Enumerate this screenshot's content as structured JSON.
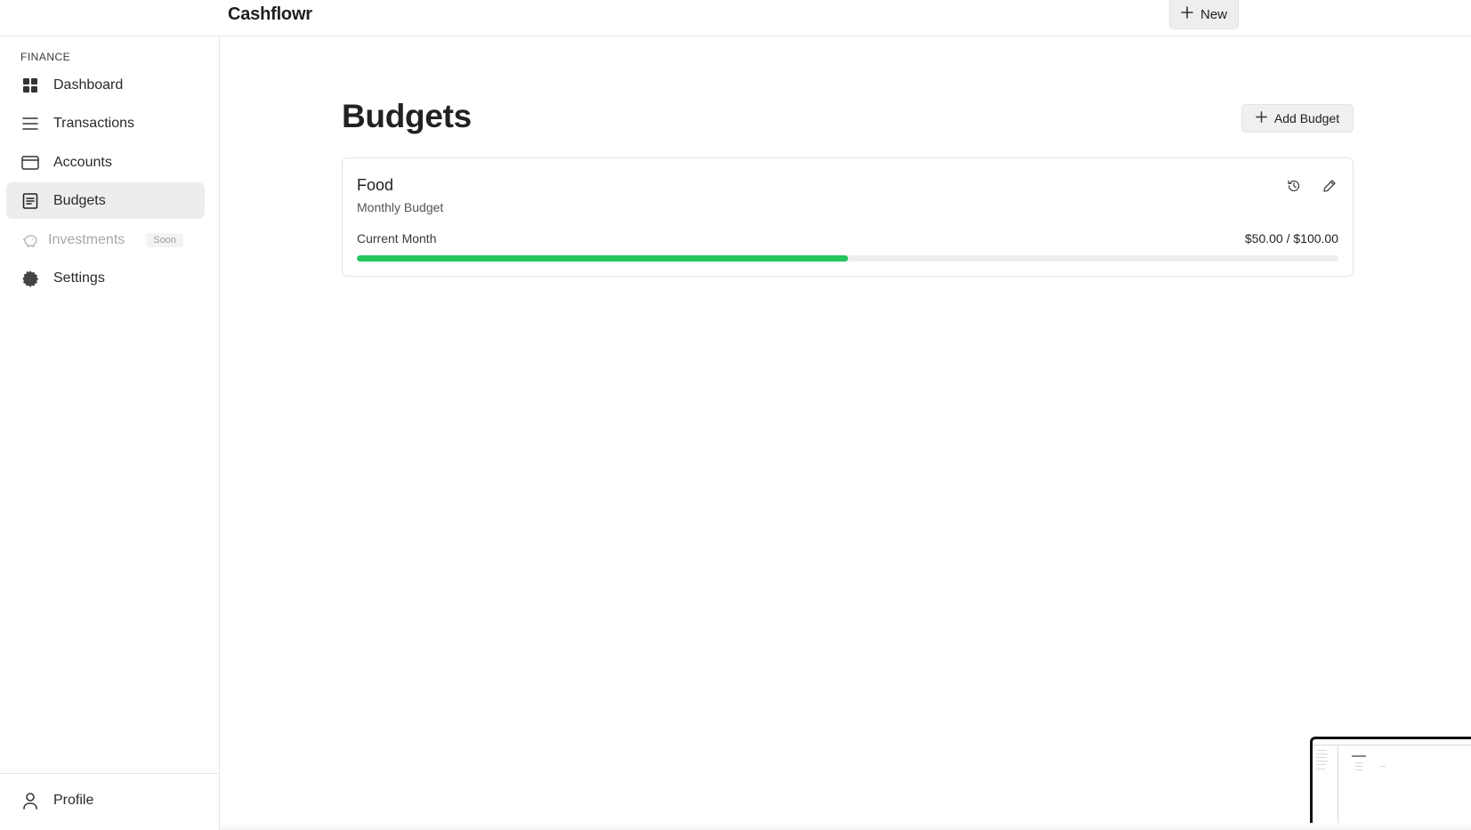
{
  "app": {
    "title": "Cashflowr",
    "new_label": "New"
  },
  "sidebar": {
    "section_label": "FINANCE",
    "items": [
      {
        "label": "Dashboard",
        "icon": "grid-icon"
      },
      {
        "label": "Transactions",
        "icon": "list-icon"
      },
      {
        "label": "Accounts",
        "icon": "card-icon"
      },
      {
        "label": "Budgets",
        "icon": "document-icon",
        "active": true
      },
      {
        "label": "Investments",
        "icon": "piggy-bank-icon",
        "disabled": true,
        "badge": "Soon"
      },
      {
        "label": "Settings",
        "icon": "gear-icon"
      }
    ],
    "footer": {
      "label": "Profile",
      "icon": "user-icon"
    }
  },
  "main": {
    "title": "Budgets",
    "add_label": "Add Budget",
    "budgets": [
      {
        "name": "Food",
        "period_type": "Monthly Budget",
        "period_label": "Current Month",
        "amount": "$50.00 / $100.00",
        "progress": 0.5
      }
    ]
  },
  "colors": {
    "progress": "#22c55e",
    "active_nav_bg": "#ededed"
  }
}
